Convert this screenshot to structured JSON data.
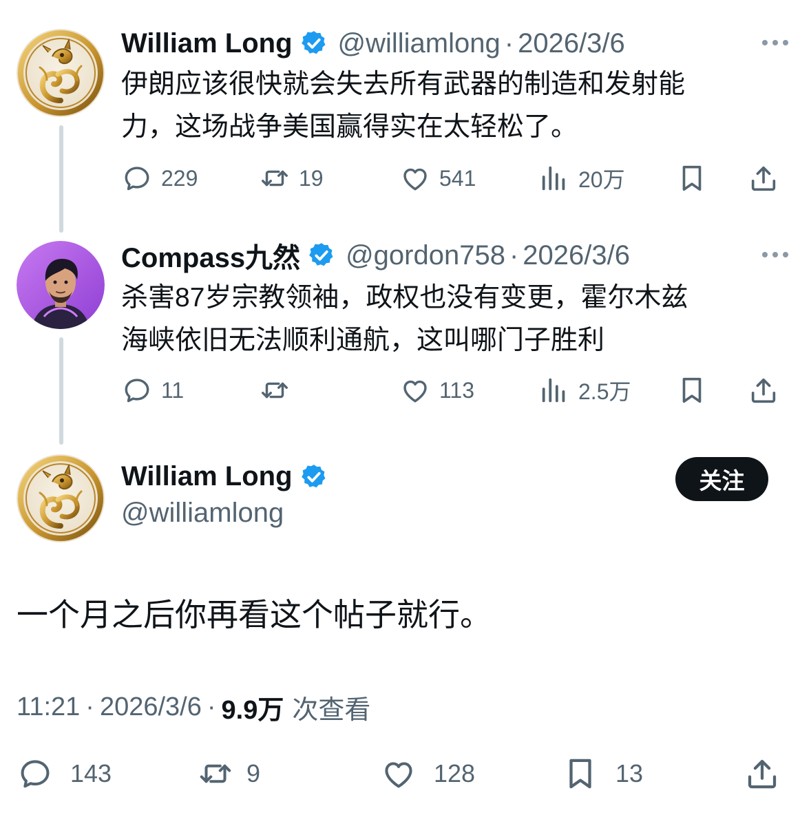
{
  "thread": [
    {
      "author": {
        "name": "William Long",
        "handle": "@williamlong",
        "avatar_icon": "golden-dragon-avatar"
      },
      "separator": "·",
      "date": "2026/3/6",
      "text_line1": "伊朗应该很快就会失去所有武器的制造和发射能",
      "text_line2": "力，这场战争美国赢得实在太轻松了。",
      "stats": {
        "replies": "229",
        "retweets": "19",
        "likes": "541",
        "views": "20万"
      }
    },
    {
      "author": {
        "name": "Compass九然",
        "handle": "@gordon758",
        "avatar_icon": "anime-man-avatar"
      },
      "separator": "·",
      "date": "2026/3/6",
      "text_line1": "杀害87岁宗教领袖，政权也没有变更，霍尔木兹",
      "text_line2": "海峡依旧无法顺利通航，这叫哪门子胜利",
      "stats": {
        "replies": "11",
        "retweets": "",
        "likes": "113",
        "views": "2.5万"
      }
    }
  ],
  "main_tweet": {
    "author": {
      "name": "William Long",
      "handle": "@williamlong",
      "avatar_icon": "golden-dragon-avatar"
    },
    "follow_label": "关注",
    "text": "一个月之后你再看这个帖子就行。",
    "time": "11:21",
    "separator": "·",
    "date": "2026/3/6",
    "views_count": "9.9万",
    "views_label": "次查看",
    "stats": {
      "replies": "143",
      "retweets": "9",
      "likes": "128",
      "bookmarks": "13"
    }
  },
  "colors": {
    "verified_blue": "#1d9bf0",
    "secondary_text": "#536471",
    "primary_text": "#0f1419",
    "thread_line": "#cfd9de",
    "follow_button_bg": "#0f1419"
  },
  "icons": [
    "reply-icon",
    "retweet-icon",
    "like-icon",
    "views-icon",
    "bookmark-icon",
    "share-icon",
    "verified-badge-icon",
    "more-options-icon"
  ]
}
